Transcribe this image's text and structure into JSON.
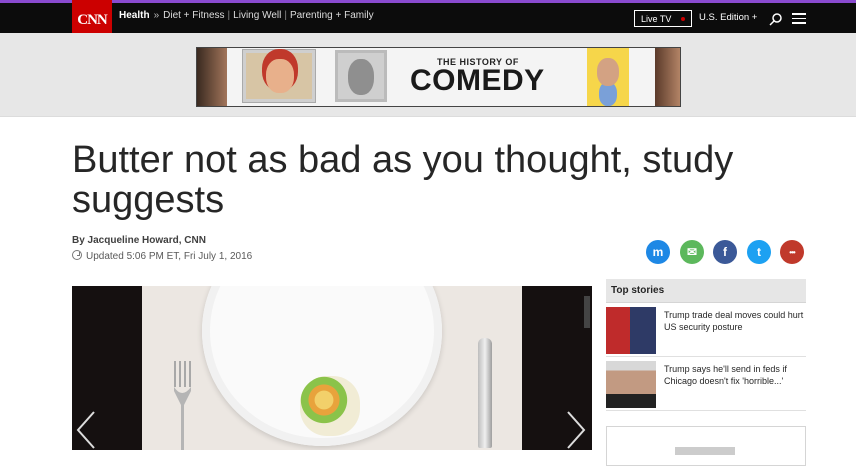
{
  "nav": {
    "logo": "CNN",
    "section": "Health",
    "separator": "»",
    "subsections": [
      "Diet + Fitness",
      "Living Well",
      "Parenting + Family"
    ],
    "live_tv": "Live TV",
    "edition": "U.S. Edition +"
  },
  "ad": {
    "kicker": "THE HISTORY OF",
    "title": "COMEDY"
  },
  "article": {
    "headline": "Butter not as bad as you thought, study suggests",
    "byline": "By Jacqueline Howard, CNN",
    "updated": "Updated 5:06 PM ET, Fri July 1, 2016"
  },
  "share": {
    "messenger": "m",
    "email": "✉",
    "facebook": "f",
    "twitter": "t",
    "more": "•••"
  },
  "top_stories": {
    "header": "Top stories",
    "items": [
      {
        "title": "Trump trade deal moves could hurt US security posture"
      },
      {
        "title": "Trump says he'll send in feds if Chicago doesn't fix 'horrible...'"
      }
    ]
  }
}
